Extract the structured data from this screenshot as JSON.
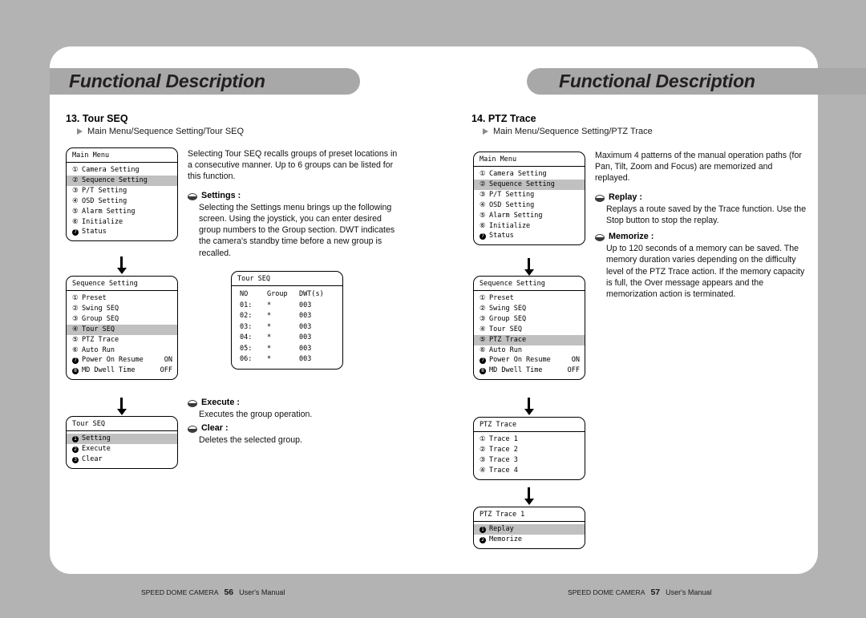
{
  "document": {
    "brand": "SPEED DOME CAMERA",
    "manual_label": "User's Manual",
    "banner_title": "Functional Description"
  },
  "colors": {
    "page_background": "#b3b3b3",
    "sheet": "#ffffff",
    "banner": "#a8a8a8",
    "highlight": "#c0c0c0",
    "text": "#111111"
  },
  "left_page": {
    "page_number": "56",
    "banner_title": "Functional Description",
    "section_number_title": "13. Tour SEQ",
    "breadcrumb": "Main Menu/Sequence Setting/Tour SEQ",
    "intro": "Selecting Tour SEQ recalls groups of preset locations in a consecutive manner. Up to 6 groups can be listed for this function.",
    "bullets": [
      {
        "label": "Settings :",
        "text": "Selecting the Settings menu brings up the following screen. Using the joystick, you can enter desired group numbers to the Group section. DWT indicates the camera's standby time before a new group is recalled."
      },
      {
        "label": "Execute :",
        "text": "Executes the group operation."
      },
      {
        "label": "Clear :",
        "text": "Deletes the selected group."
      }
    ],
    "menus": [
      {
        "title": "Main Menu",
        "rows": [
          {
            "num": "①",
            "label": "Camera Setting",
            "value": "",
            "highlight": false,
            "filled": false
          },
          {
            "num": "②",
            "label": "Sequence Setting",
            "value": "",
            "highlight": true,
            "filled": false
          },
          {
            "num": "③",
            "label": "P/T Setting",
            "value": "",
            "highlight": false,
            "filled": false
          },
          {
            "num": "④",
            "label": "OSD Setting",
            "value": "",
            "highlight": false,
            "filled": false
          },
          {
            "num": "⑤",
            "label": "Alarm Setting",
            "value": "",
            "highlight": false,
            "filled": false
          },
          {
            "num": "⑥",
            "label": "Initialize",
            "value": "",
            "highlight": false,
            "filled": false
          },
          {
            "num": "7",
            "label": "Status",
            "value": "",
            "highlight": false,
            "filled": true
          }
        ]
      },
      {
        "title": "Sequence Setting",
        "rows": [
          {
            "num": "①",
            "label": "Preset",
            "value": "",
            "highlight": false,
            "filled": false
          },
          {
            "num": "②",
            "label": "Swing SEQ",
            "value": "",
            "highlight": false,
            "filled": false
          },
          {
            "num": "③",
            "label": "Group SEQ",
            "value": "",
            "highlight": false,
            "filled": false
          },
          {
            "num": "④",
            "label": "Tour SEQ",
            "value": "",
            "highlight": true,
            "filled": false
          },
          {
            "num": "⑤",
            "label": "PTZ Trace",
            "value": "",
            "highlight": false,
            "filled": false
          },
          {
            "num": "⑥",
            "label": "Auto Run",
            "value": "",
            "highlight": false,
            "filled": false
          },
          {
            "num": "7",
            "label": "Power On Resume",
            "value": "ON",
            "highlight": false,
            "filled": true
          },
          {
            "num": "8",
            "label": "MD Dwell Time",
            "value": "OFF",
            "highlight": false,
            "filled": true
          }
        ]
      },
      {
        "title": "Tour SEQ",
        "rows": [
          {
            "num": "1",
            "label": "Setting",
            "value": "",
            "highlight": true,
            "filled": true
          },
          {
            "num": "2",
            "label": "Execute",
            "value": "",
            "highlight": false,
            "filled": true
          },
          {
            "num": "3",
            "label": "Clear",
            "value": "",
            "highlight": false,
            "filled": true
          }
        ]
      }
    ],
    "table": {
      "title": "Tour SEQ",
      "headers": [
        "NO",
        "Group",
        "DWT(s)"
      ],
      "rows": [
        [
          "01:",
          "*",
          "003"
        ],
        [
          "02:",
          "*",
          "003"
        ],
        [
          "03:",
          "*",
          "003"
        ],
        [
          "04:",
          "*",
          "003"
        ],
        [
          "05:",
          "*",
          "003"
        ],
        [
          "06:",
          "*",
          "003"
        ]
      ]
    }
  },
  "right_page": {
    "page_number": "57",
    "banner_title": "Functional Description",
    "section_number_title": "14. PTZ Trace",
    "breadcrumb": "Main Menu/Sequence Setting/PTZ Trace",
    "intro": "Maximum 4 patterns of the manual operation paths (for Pan, Tilt, Zoom and Focus) are memorized and replayed.",
    "bullets": [
      {
        "label": "Replay :",
        "text": "Replays a route saved by the Trace function. Use the Stop button to stop the replay."
      },
      {
        "label": "Memorize :",
        "text": "Up to 120 seconds of a memory can be saved. The memory duration varies depending on the difficulty level of the PTZ Trace action. If the memory capacity is full, the Over message appears and the memorization action is terminated."
      }
    ],
    "menus": [
      {
        "title": "Main Menu",
        "rows": [
          {
            "num": "①",
            "label": "Camera Setting",
            "value": "",
            "highlight": false,
            "filled": false
          },
          {
            "num": "②",
            "label": "Sequence Setting",
            "value": "",
            "highlight": true,
            "filled": false
          },
          {
            "num": "③",
            "label": "P/T Setting",
            "value": "",
            "highlight": false,
            "filled": false
          },
          {
            "num": "④",
            "label": "OSD Setting",
            "value": "",
            "highlight": false,
            "filled": false
          },
          {
            "num": "⑤",
            "label": "Alarm Setting",
            "value": "",
            "highlight": false,
            "filled": false
          },
          {
            "num": "⑥",
            "label": "Initialize",
            "value": "",
            "highlight": false,
            "filled": false
          },
          {
            "num": "7",
            "label": "Status",
            "value": "",
            "highlight": false,
            "filled": true
          }
        ]
      },
      {
        "title": "Sequence Setting",
        "rows": [
          {
            "num": "①",
            "label": "Preset",
            "value": "",
            "highlight": false,
            "filled": false
          },
          {
            "num": "②",
            "label": "Swing SEQ",
            "value": "",
            "highlight": false,
            "filled": false
          },
          {
            "num": "③",
            "label": "Group SEQ",
            "value": "",
            "highlight": false,
            "filled": false
          },
          {
            "num": "④",
            "label": "Tour SEQ",
            "value": "",
            "highlight": false,
            "filled": false
          },
          {
            "num": "⑤",
            "label": "PTZ Trace",
            "value": "",
            "highlight": true,
            "filled": false
          },
          {
            "num": "⑥",
            "label": "Auto Run",
            "value": "",
            "highlight": false,
            "filled": false
          },
          {
            "num": "7",
            "label": "Power On Resume",
            "value": "ON",
            "highlight": false,
            "filled": true
          },
          {
            "num": "8",
            "label": "MD Dwell Time",
            "value": "OFF",
            "highlight": false,
            "filled": true
          }
        ]
      },
      {
        "title": "PTZ Trace",
        "rows": [
          {
            "num": "①",
            "label": "Trace 1",
            "value": "",
            "highlight": false,
            "filled": false
          },
          {
            "num": "②",
            "label": "Trace 2",
            "value": "",
            "highlight": false,
            "filled": false
          },
          {
            "num": "③",
            "label": "Trace 3",
            "value": "",
            "highlight": false,
            "filled": false
          },
          {
            "num": "④",
            "label": "Trace 4",
            "value": "",
            "highlight": false,
            "filled": false
          }
        ]
      },
      {
        "title": "PTZ Trace 1",
        "rows": [
          {
            "num": "1",
            "label": "Replay",
            "value": "",
            "highlight": true,
            "filled": true
          },
          {
            "num": "2",
            "label": "Memorize",
            "value": "",
            "highlight": false,
            "filled": true
          }
        ]
      }
    ]
  }
}
